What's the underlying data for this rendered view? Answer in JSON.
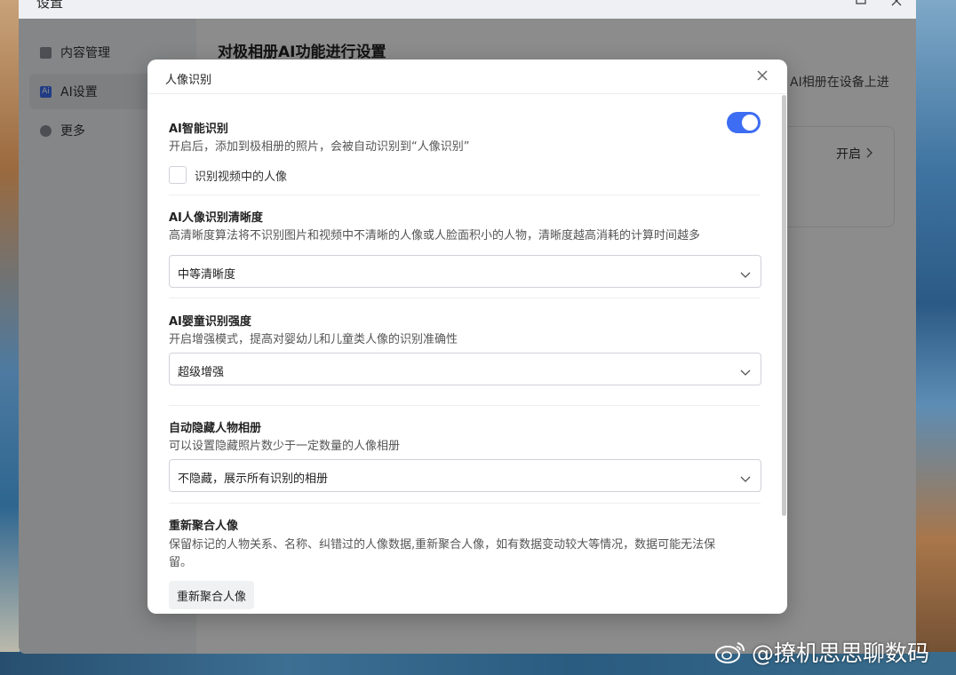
{
  "window": {
    "title": "设置",
    "sidebar": [
      {
        "label": "内容管理",
        "icon": "document-icon"
      },
      {
        "label": "AI设置",
        "icon": "ai-icon",
        "icon_text": "Ai"
      },
      {
        "label": "更多",
        "icon": "more-icon"
      }
    ],
    "content_title": "对极相册AI功能进行设置",
    "content_desc": "AI相册在设备上进",
    "card_action": "开启"
  },
  "dialog": {
    "title": "人像识别",
    "sections": {
      "smart": {
        "title": "AI智能识别",
        "desc": "开启后，添加到极相册的照片，会被自动识别到“人像识别”",
        "toggle_on": true,
        "checkbox_label": "识别视频中的人像",
        "checkbox_checked": false
      },
      "clarity": {
        "title": "AI人像识别清晰度",
        "desc": "高清晰度算法将不识别图片和视频中不清晰的人像或人脸面积小的人物，清晰度越高消耗的计算时间越多",
        "selected": "中等清晰度"
      },
      "child": {
        "title": "AI婴童识别强度",
        "desc": "开启增强模式，提高对婴幼儿和儿童类人像的识别准确性",
        "selected": "超级增强"
      },
      "hide": {
        "title": "自动隐藏人物相册",
        "desc": "可以设置隐藏照片数少于一定数量的人像相册",
        "selected": "不隐藏，展示所有识别的相册"
      },
      "recluster": {
        "title": "重新聚合人像",
        "desc_line1": "保留标记的人物关系、名称、纠错过的人像数据,重新聚合人像，如有数据变动较大等情况，数据可能无法保",
        "desc_line2": "留。",
        "button": "重新聚合人像"
      }
    }
  },
  "watermark": "@撩机思思聊数码",
  "colors": {
    "accent": "#3d6df2"
  }
}
